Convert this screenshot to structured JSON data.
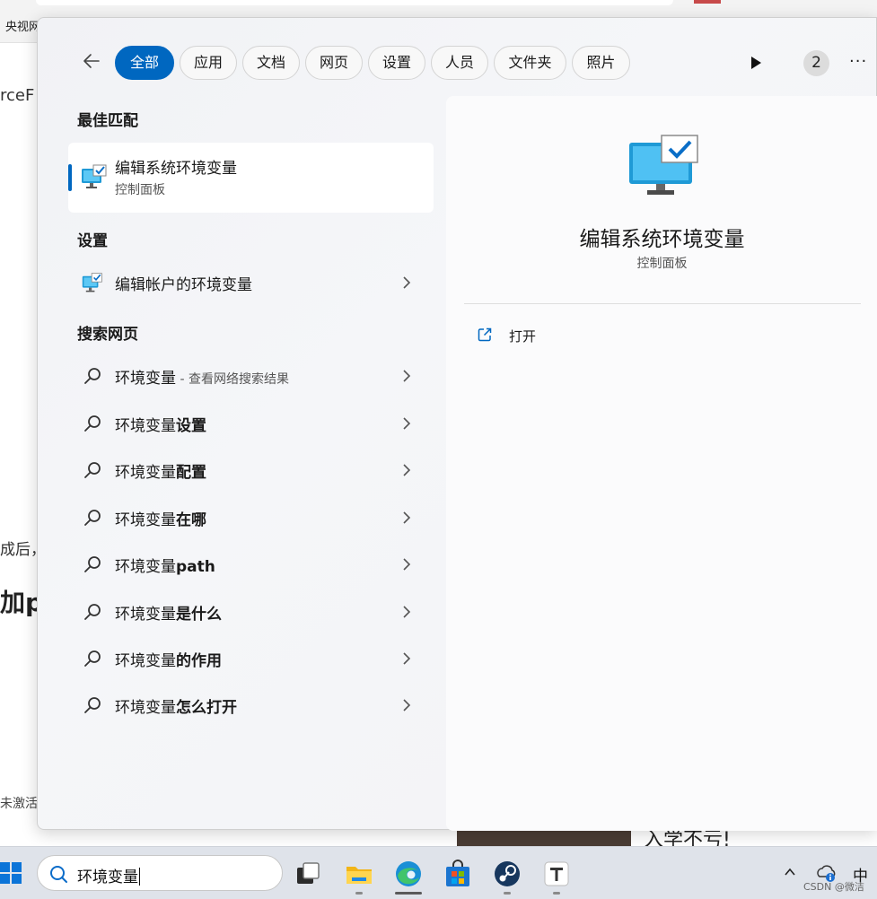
{
  "background": {
    "tab_text": "央视网",
    "text_fragment_1": "rceF",
    "text_fragment_2": "成后，",
    "text_fragment_3": "加p",
    "text_fragment_4": "未激活",
    "text_fragment_5": "入学不亏!"
  },
  "filters": {
    "back_label": "返回",
    "chips": [
      "全部",
      "应用",
      "文档",
      "网页",
      "设置",
      "人员",
      "文件夹",
      "照片"
    ],
    "active_chip": "全部",
    "badge_count": "2",
    "more_label": "···"
  },
  "best_match": {
    "section_title": "最佳匹配",
    "title": "编辑系统环境变量",
    "subtitle": "控制面板"
  },
  "settings": {
    "section_title": "设置",
    "item": "编辑帐户的环境变量"
  },
  "web": {
    "section_title": "搜索网页",
    "first": {
      "prefix": "环境变量",
      "suffix": " - 查看网络搜索结果"
    },
    "items": [
      {
        "prefix": "环境变量",
        "bold": "设置"
      },
      {
        "prefix": "环境变量",
        "bold": "配置"
      },
      {
        "prefix": "环境变量",
        "bold": "在哪"
      },
      {
        "prefix": "环境变量",
        "bold": "path"
      },
      {
        "prefix": "环境变量",
        "bold": "是什么"
      },
      {
        "prefix": "环境变量",
        "bold": "的作用"
      },
      {
        "prefix": "环境变量",
        "bold": "怎么打开"
      }
    ]
  },
  "detail": {
    "title": "编辑系统环境变量",
    "subtitle": "控制面板",
    "open_label": "打开"
  },
  "taskbar": {
    "search_value": "环境变量",
    "ime": "中",
    "watermark": "CSDN @微洁"
  },
  "colors": {
    "accent": "#0067c0",
    "panel": "#f3f4f7"
  }
}
